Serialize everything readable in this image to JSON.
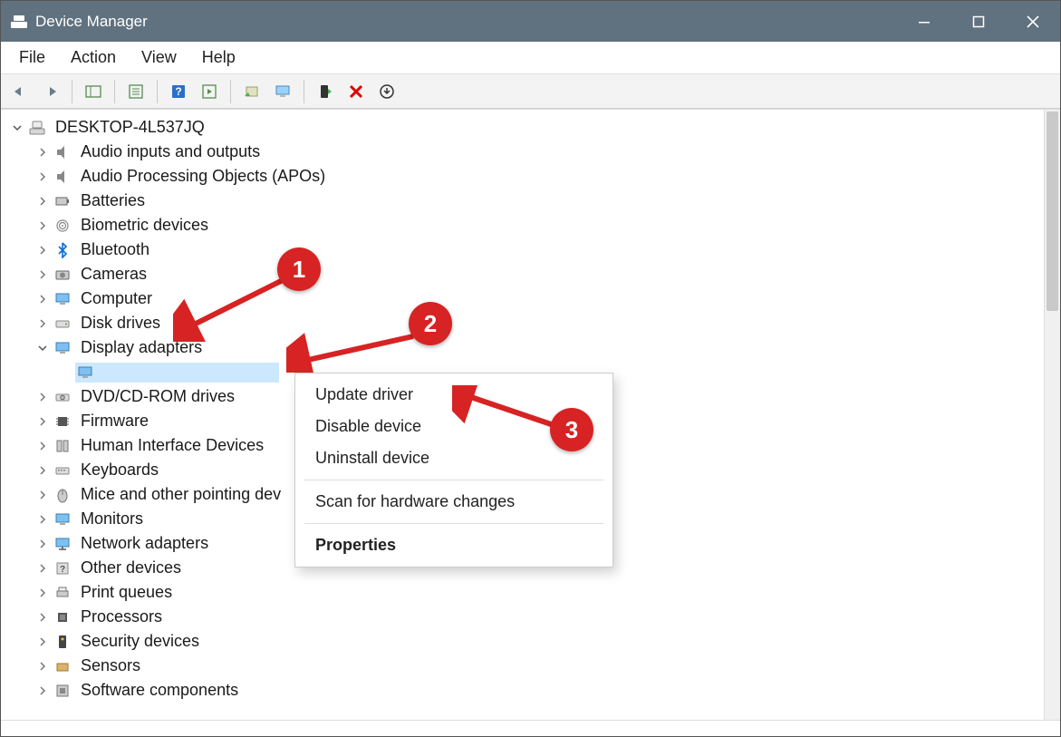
{
  "window": {
    "title": "Device Manager"
  },
  "menu": {
    "file": "File",
    "action": "Action",
    "view": "View",
    "help": "Help"
  },
  "tree": {
    "root": "DESKTOP-4L537JQ",
    "items": [
      "Audio inputs and outputs",
      "Audio Processing Objects (APOs)",
      "Batteries",
      "Biometric devices",
      "Bluetooth",
      "Cameras",
      "Computer",
      "Disk drives",
      "Display adapters",
      "DVD/CD-ROM drives",
      "Firmware",
      "Human Interface Devices",
      "Keyboards",
      "Mice and other pointing dev",
      "Monitors",
      "Network adapters",
      "Other devices",
      "Print queues",
      "Processors",
      "Security devices",
      "Sensors",
      "Software components"
    ],
    "selected_child": ""
  },
  "context_menu": {
    "update": "Update driver",
    "disable": "Disable device",
    "uninstall": "Uninstall device",
    "scan": "Scan for hardware changes",
    "properties": "Properties"
  },
  "annotations": {
    "b1": "1",
    "b2": "2",
    "b3": "3"
  }
}
